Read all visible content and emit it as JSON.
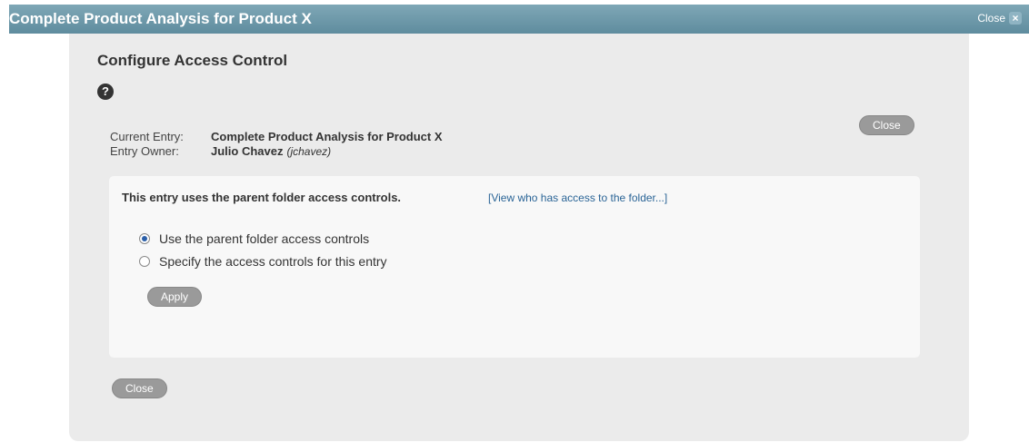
{
  "window": {
    "title": "Complete Product Analysis for Product X",
    "close_label": "Close"
  },
  "dialog": {
    "heading": "Configure Access Control",
    "help_icon": "?",
    "close_label": "Close"
  },
  "entry": {
    "current_label": "Current Entry:",
    "current_value": "Complete Product Analysis for Product X",
    "owner_label": "Entry Owner:",
    "owner_name": "Julio Chavez",
    "owner_id": "(jchavez)"
  },
  "access": {
    "message": "This entry uses the parent folder access controls.",
    "view_link": "[View who has access to the folder...]",
    "options": [
      {
        "label": "Use the parent folder access controls",
        "checked": true
      },
      {
        "label": "Specify the access controls for this entry",
        "checked": false
      }
    ],
    "apply_label": "Apply"
  },
  "footer": {
    "close_label": "Close"
  },
  "colors": {
    "titlebar": "#6f9aab",
    "panel": "#ebebeb",
    "inner": "#f8f8f8",
    "link": "#2a6496",
    "button": "#9a9a9a"
  }
}
